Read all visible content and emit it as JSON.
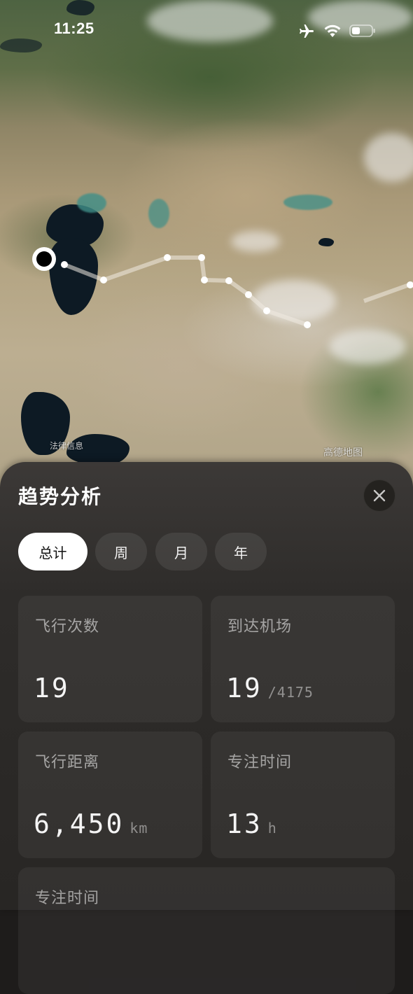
{
  "status_bar": {
    "time": "11:25",
    "icons": [
      "airplane-icon",
      "wifi-icon",
      "battery-icon"
    ]
  },
  "map": {
    "legal_label": "法律信息",
    "provider_label": "高德地图"
  },
  "sheet": {
    "title": "趋势分析",
    "close_icon": "close-icon",
    "tabs": [
      {
        "label": "总计",
        "active": true
      },
      {
        "label": "周",
        "active": false
      },
      {
        "label": "月",
        "active": false
      },
      {
        "label": "年",
        "active": false
      }
    ],
    "cards": [
      {
        "label": "飞行次数",
        "value": "19",
        "unit": ""
      },
      {
        "label": "到达机场",
        "value": "19",
        "unit": "/4175"
      },
      {
        "label": "飞行距离",
        "value": "6,450",
        "unit": "km"
      },
      {
        "label": "专注时间",
        "value": "13",
        "unit": "h"
      },
      {
        "label": "专注时间",
        "value": "",
        "unit": ""
      }
    ]
  },
  "colors": {
    "sheet_bg": "#2e2c2a",
    "card_bg": "#3a3836",
    "active_tab": "#ffffff"
  }
}
